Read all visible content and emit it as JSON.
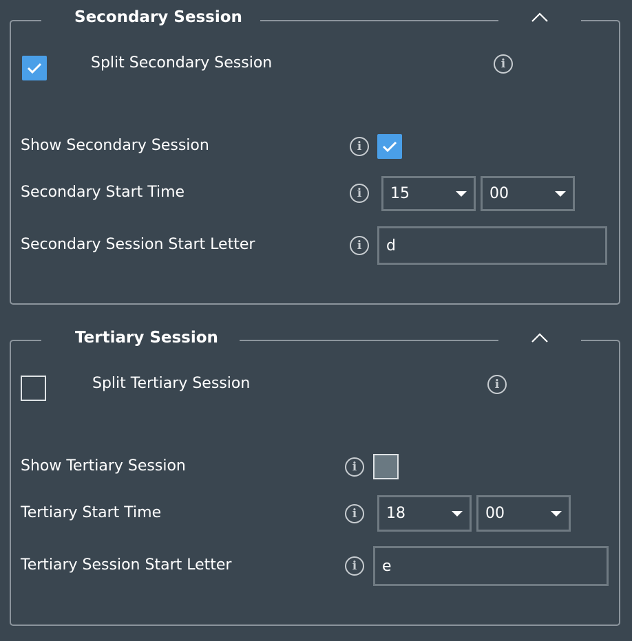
{
  "secondary": {
    "title": "Secondary Session",
    "split_label": "Split Secondary Session",
    "split_checked": true,
    "show_label": "Show Secondary Session",
    "show_checked": true,
    "start_time_label": "Secondary Start Time",
    "hour": "15",
    "minute": "00",
    "start_letter_label": "Secondary Session Start Letter",
    "start_letter": "d"
  },
  "tertiary": {
    "title": "Tertiary Session",
    "split_label": "Split Tertiary Session",
    "split_checked": false,
    "show_label": "Show Tertiary Session",
    "show_checked": false,
    "start_time_label": "Tertiary Start Time",
    "hour": "18",
    "minute": "00",
    "start_letter_label": "Tertiary Session Start Letter",
    "start_letter": "e"
  },
  "icons": {
    "info": "info-circle-icon",
    "collapse": "chevron-up-icon",
    "check": "checkmark-icon",
    "dropdown": "caret-down-icon"
  },
  "colors": {
    "background": "#3a4650",
    "accent": "#4a9fe8",
    "border": "#8c959d"
  }
}
